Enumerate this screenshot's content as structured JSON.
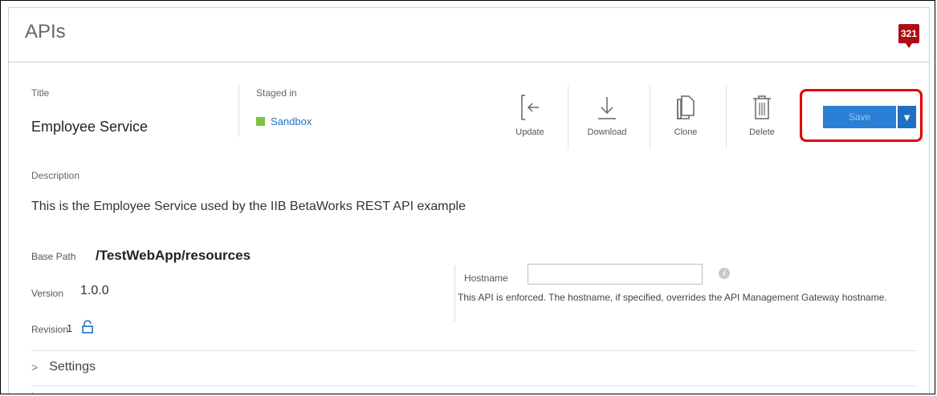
{
  "header": {
    "title": "APIs",
    "notification_count": "321"
  },
  "api": {
    "title_label": "Title",
    "title": "Employee Service",
    "staged_label": "Staged in",
    "staged_value": "Sandbox",
    "description_label": "Description",
    "description": "This is the Employee Service used by the IIB BetaWorks REST API example",
    "base_path_label": "Base Path",
    "base_path": "/TestWebApp/resources",
    "version_label": "Version",
    "version": "1.0.0",
    "revision_label": "Revision",
    "revision": "1"
  },
  "toolbar": {
    "update_label": "Update",
    "download_label": "Download",
    "clone_label": "Clone",
    "delete_label": "Delete",
    "save_label": "Save",
    "save_dropdown_icon": "caret-down-icon"
  },
  "hostname": {
    "label": "Hostname",
    "value": "",
    "note": "This API is enforced. The hostname, if specified, overrides the API Management Gateway hostname."
  },
  "sections": {
    "settings_label": "Settings"
  },
  "colors": {
    "accent": "#2b7fd4",
    "sandbox": "#7cc23b",
    "notification": "#b00d12",
    "highlight": "#e00000"
  }
}
